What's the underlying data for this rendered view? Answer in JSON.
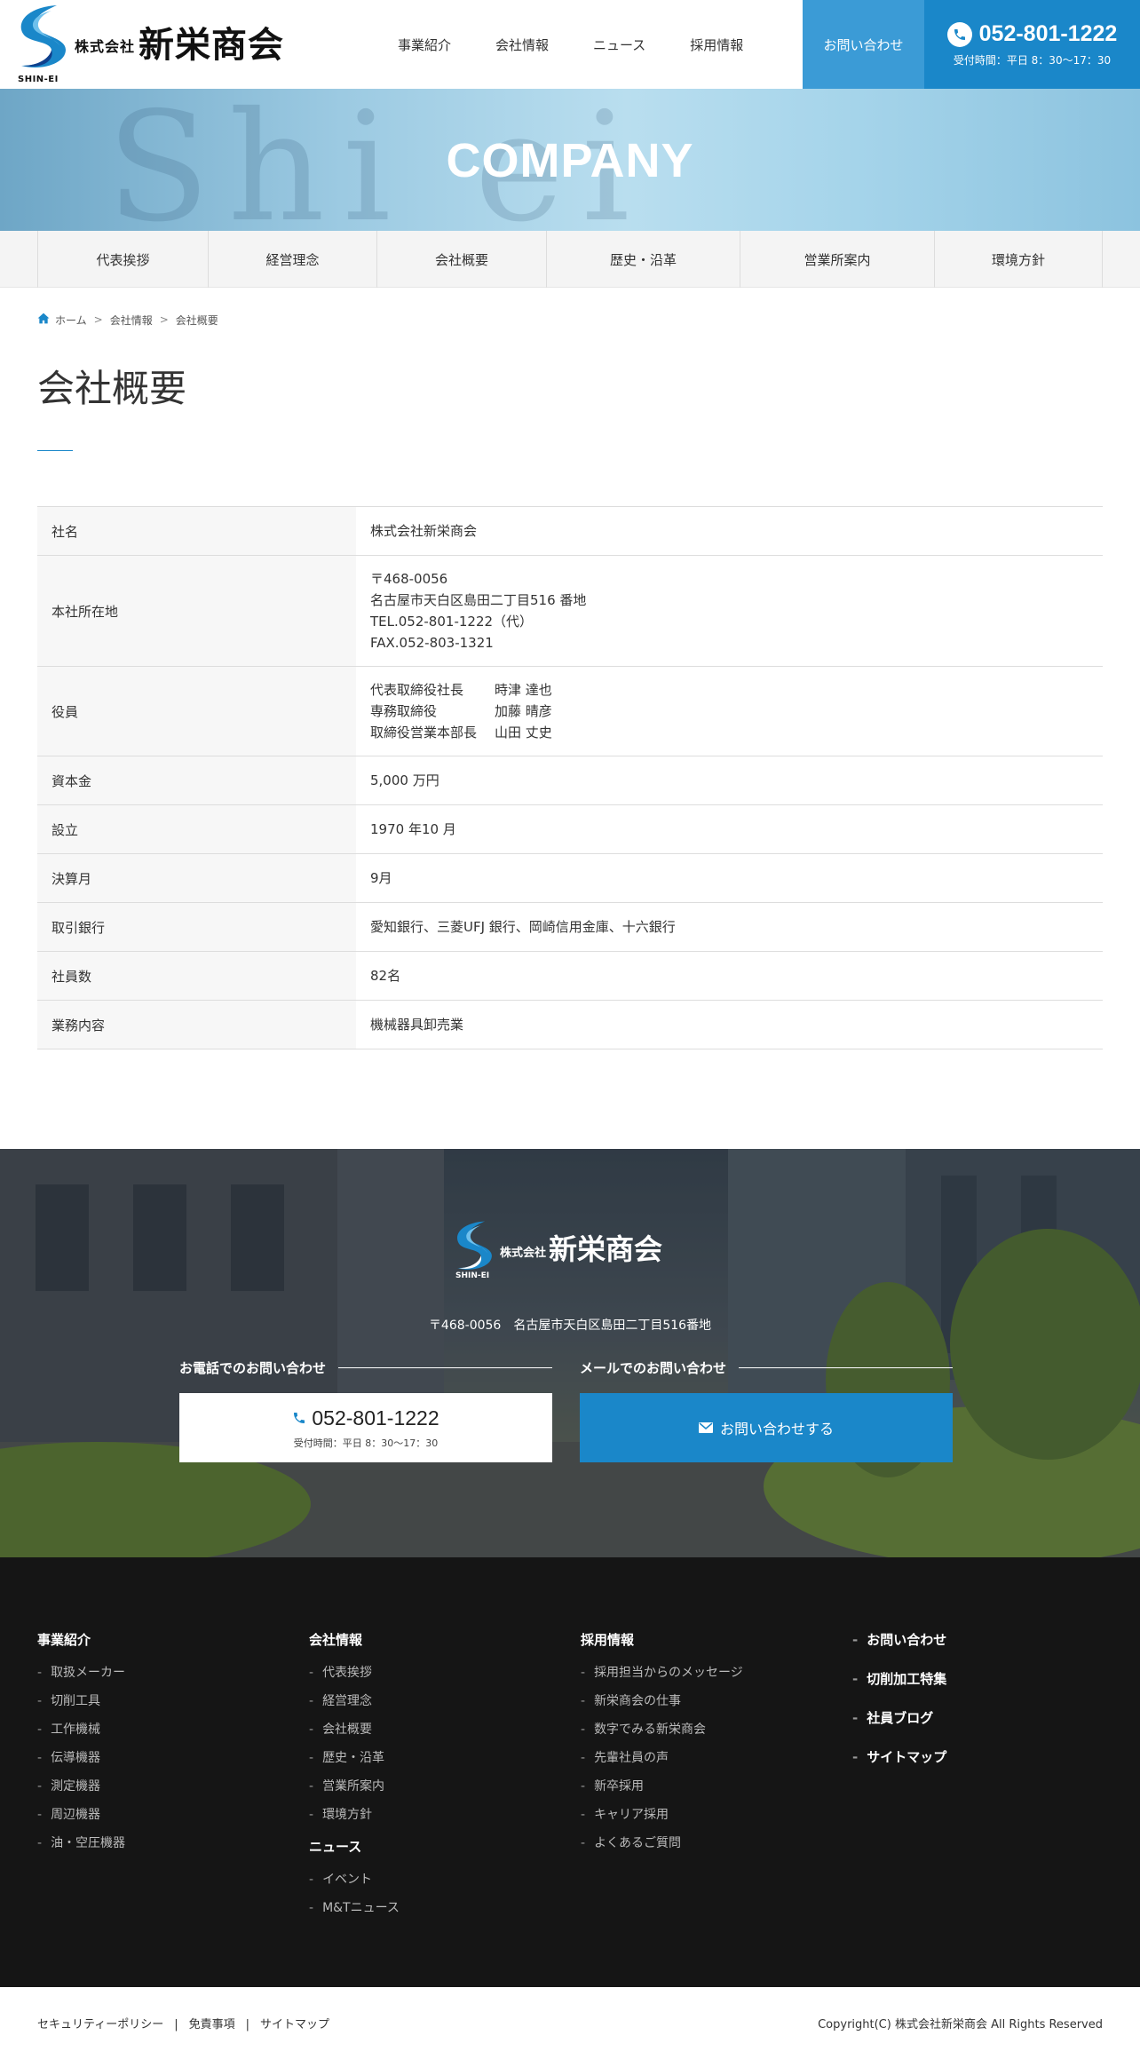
{
  "header": {
    "logo_kanji_small": "株式会社",
    "logo_kanji": "新栄商会",
    "logo_en": "SHIN-EI",
    "nav": [
      "事業紹介",
      "会社情報",
      "ニュース",
      "採用情報"
    ],
    "contact_button": "お問い合わせ",
    "tel": "052-801-1222",
    "tel_hours": "受付時間：平日 8：30～17：30"
  },
  "hero": {
    "decoration": "Shi ei",
    "title": "COMPANY"
  },
  "subnav": [
    "代表挨拶",
    "経営理念",
    "会社概要",
    "歴史・沿革",
    "営業所案内",
    "環境方針"
  ],
  "breadcrumb": [
    "ホーム",
    "会社情報",
    "会社概要"
  ],
  "page_title": "会社概要",
  "company_table": {
    "name_label": "社名",
    "name_value": "株式会社新栄商会",
    "address_label": "本社所在地",
    "address_lines": [
      "〒468-0056",
      "名古屋市天白区島田二丁目516 番地",
      "TEL.052-801-1222（代）",
      "FAX.052-803-1321"
    ],
    "executives_label": "役員",
    "executives": [
      {
        "role": "代表取締役社長",
        "name": "時津 達也"
      },
      {
        "role": "専務取締役",
        "name": "加藤 晴彦"
      },
      {
        "role": "取締役営業本部長",
        "name": "山田 丈史"
      }
    ],
    "capital_label": "資本金",
    "capital_value": "5,000 万円",
    "founded_label": "設立",
    "founded_value": "1970 年10 月",
    "fiscal_label": "決算月",
    "fiscal_value": "9月",
    "banks_label": "取引銀行",
    "banks_value": "愛知銀行、三菱UFJ 銀行、岡崎信用金庫、十六銀行",
    "employees_label": "社員数",
    "employees_value": "82名",
    "business_label": "業務内容",
    "business_value": "機械器具卸売業"
  },
  "contact_band": {
    "logo_kanji_small": "株式会社",
    "logo_kanji": "新栄商会",
    "logo_en": "SHIN-EI",
    "address": "〒468-0056　名古屋市天白区島田二丁目516番地",
    "phone_heading": "お電話でのお問い合わせ",
    "mail_heading": "メールでのお問い合わせ",
    "tel": "052-801-1222",
    "tel_hours": "受付時間：平日 8：30～17：30",
    "mail_button": "お問い合わせする"
  },
  "footer": {
    "col1": {
      "heading": "事業紹介",
      "items": [
        "取扱メーカー",
        "切削工具",
        "工作機械",
        "伝導機器",
        "測定機器",
        "周辺機器",
        "油・空圧機器"
      ]
    },
    "col2": {
      "heading": "会社情報",
      "items": [
        "代表挨拶",
        "経営理念",
        "会社概要",
        "歴史・沿革",
        "営業所案内",
        "環境方針"
      ],
      "sub_heading": "ニュース",
      "sub_items": [
        "イベント",
        "M&Tニュース"
      ]
    },
    "col3": {
      "heading": "採用情報",
      "items": [
        "採用担当からのメッセージ",
        "新栄商会の仕事",
        "数字でみる新栄商会",
        "先輩社員の声",
        "新卒採用",
        "キャリア採用",
        "よくあるご質問"
      ]
    },
    "col4": {
      "links": [
        "お問い合わせ",
        "切削加工特集",
        "社員ブログ",
        "サイトマップ"
      ]
    }
  },
  "bottom": {
    "links": [
      "セキュリティーポリシー",
      "免責事項",
      "サイトマップ"
    ],
    "separator": "|",
    "copyright": "Copyright(C) 株式会社新栄商会 All Rights Reserved"
  },
  "colors": {
    "brand_blue": "#1a87c9",
    "contact_button": "#3b9bd6",
    "footer_bg": "#151515"
  }
}
